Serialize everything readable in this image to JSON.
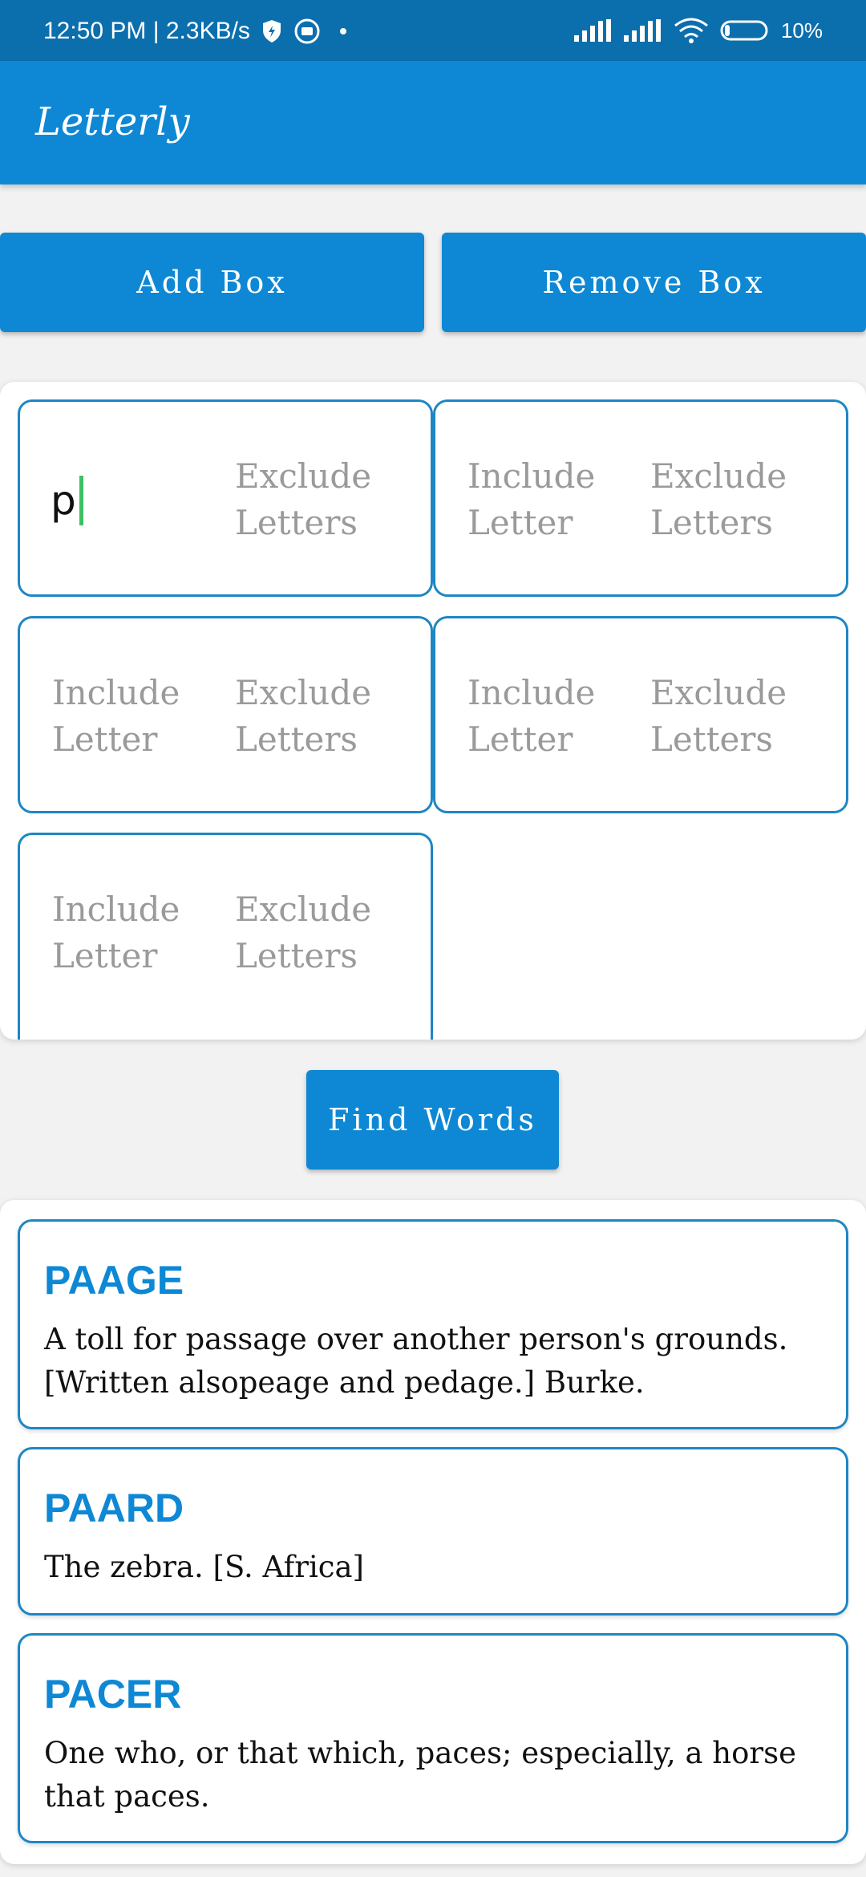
{
  "status_bar": {
    "time": "12:50 PM | 2.3KB/s",
    "battery": "10%"
  },
  "app": {
    "title": "Letterly"
  },
  "buttons": {
    "add_box": "Add Box",
    "remove_box": "Remove Box",
    "find_words": "Find Words"
  },
  "boxes": [
    {
      "include_value": "p",
      "include_placeholder": "Include Letter",
      "exclude_placeholder": "Exclude Letters",
      "focused": true
    },
    {
      "include_value": "",
      "include_placeholder": "Include Letter",
      "exclude_placeholder": "Exclude Letters"
    },
    {
      "include_value": "",
      "include_placeholder": "Include Letter",
      "exclude_placeholder": "Exclude Letters"
    },
    {
      "include_value": "",
      "include_placeholder": "Include Letter",
      "exclude_placeholder": "Exclude Letters"
    },
    {
      "include_value": "",
      "include_placeholder": "Include Letter",
      "exclude_placeholder": "Exclude Letters"
    }
  ],
  "results": [
    {
      "word": "PAAGE",
      "definition": "A toll for passage over another person's grounds. [Written alsopeage and pedage.]  Burke."
    },
    {
      "word": "PAARD",
      "definition": "The zebra. [S. Africa]"
    },
    {
      "word": "PACER",
      "definition": "One who, or that which, paces; especially, a horse that paces."
    }
  ],
  "colors": {
    "primary": "#0e88d4",
    "status_bar": "#0c6fad",
    "border": "#1f86c4",
    "placeholder": "#9a9a9a",
    "caret": "#3fbf63"
  }
}
